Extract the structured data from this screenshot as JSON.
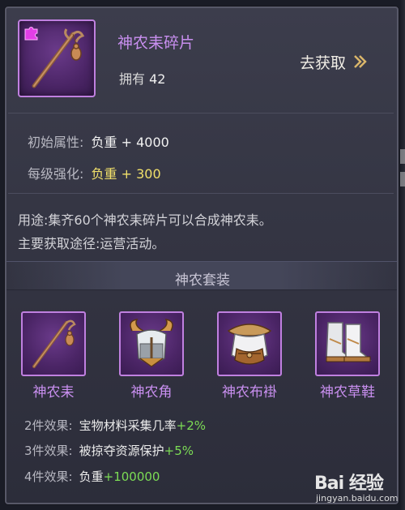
{
  "item": {
    "name": "神农耒碎片",
    "own_label": "拥有",
    "own_count": "42",
    "goto_label": "去获取",
    "icon": "staff-fragment-icon"
  },
  "attributes": {
    "base_label": "初始属性:",
    "base_value": "负重 + 4000",
    "level_label": "每级强化:",
    "level_value": "负重 + 300",
    "level_color": "#f1e06a"
  },
  "description": {
    "usage": "用途:集齐60个神农耒碎片可以合成神农耒。",
    "source": "主要获取途径:运营活动。"
  },
  "set": {
    "title": "神农套装",
    "items": [
      {
        "name": "神农耒",
        "icon": "staff-icon"
      },
      {
        "name": "神农角",
        "icon": "horned-helmet-icon"
      },
      {
        "name": "神农布褂",
        "icon": "robe-armor-icon"
      },
      {
        "name": "神农草鞋",
        "icon": "boots-icon"
      }
    ],
    "effects": [
      {
        "label": "2件效果:",
        "text": "宝物材料采集几率",
        "bonus": "+2%"
      },
      {
        "label": "3件效果:",
        "text": "被掠夺资源保护",
        "bonus": "+5%"
      },
      {
        "label": "4件效果:",
        "text": "负重",
        "bonus": "+100000"
      }
    ]
  },
  "watermark": {
    "main": "Bai 经验",
    "sub": "jingyan.baidu.com"
  },
  "colors": {
    "rarity_purple": "#c080e0",
    "item_name": "#c98ff0",
    "bonus_green": "#7cdc55"
  }
}
